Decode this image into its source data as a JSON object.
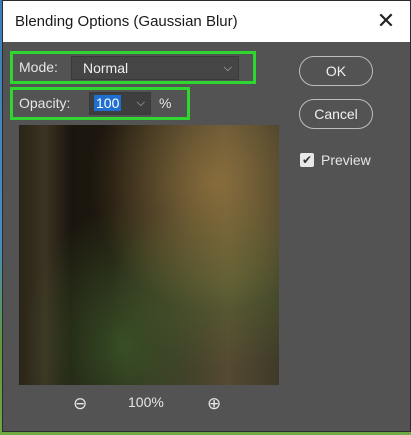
{
  "window": {
    "title": "Blending Options (Gaussian Blur)"
  },
  "mode": {
    "label": "Mode:",
    "value": "Normal"
  },
  "opacity": {
    "label": "Opacity:",
    "value": "100",
    "unit": "%"
  },
  "buttons": {
    "ok": "OK",
    "cancel": "Cancel"
  },
  "preview_option": {
    "label": "Preview",
    "checked": true
  },
  "zoom": {
    "level": "100%"
  },
  "colors": {
    "highlight": "#2fd62f",
    "dialog_bg": "#535353",
    "selection": "#1f6fd1"
  }
}
